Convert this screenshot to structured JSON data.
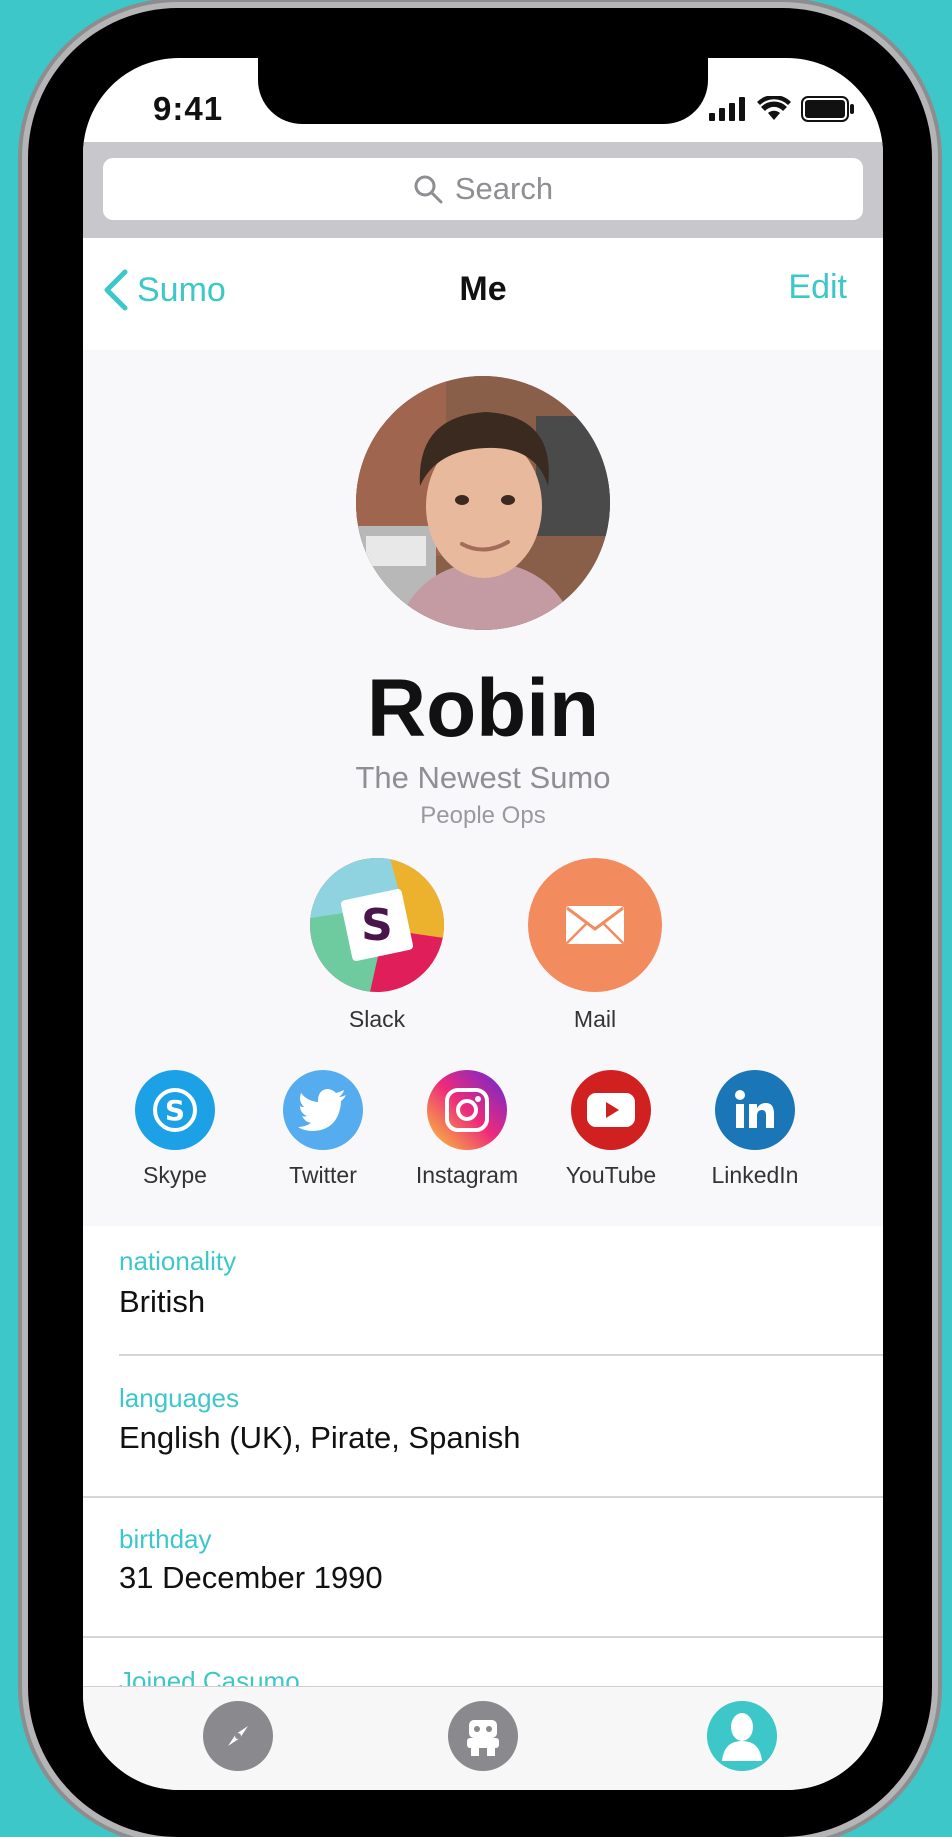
{
  "status": {
    "time": "9:41"
  },
  "search": {
    "placeholder": "Search"
  },
  "nav": {
    "back_label": "Sumo",
    "title": "Me",
    "edit_label": "Edit"
  },
  "profile": {
    "name": "Robin",
    "title": "The Newest Sumo",
    "department": "People Ops"
  },
  "primary_actions": [
    {
      "label": "Slack",
      "icon": "slack-icon"
    },
    {
      "label": "Mail",
      "icon": "mail-icon",
      "color": "#f28b5e"
    }
  ],
  "social_links": [
    {
      "label": "Skype",
      "icon": "skype-icon",
      "color": "#1da1e6"
    },
    {
      "label": "Twitter",
      "icon": "twitter-icon",
      "color": "#55acee"
    },
    {
      "label": "Instagram",
      "icon": "instagram-icon",
      "color": "#c13584"
    },
    {
      "label": "YouTube",
      "icon": "youtube-icon",
      "color": "#d0201f"
    },
    {
      "label": "LinkedIn",
      "icon": "linkedin-icon",
      "color": "#1a76b6"
    }
  ],
  "fields": [
    {
      "key": "nationality",
      "value": "British"
    },
    {
      "key": "languages",
      "value": "English (UK), Pirate, Spanish"
    },
    {
      "key": "birthday",
      "value": "31 December 1990"
    },
    {
      "key": "Joined Casumo",
      "value": ""
    }
  ],
  "tabbar": [
    {
      "icon": "compass-icon",
      "active": false
    },
    {
      "icon": "robot-icon",
      "active": false
    },
    {
      "icon": "profile-icon",
      "active": true
    }
  ],
  "colors": {
    "accent": "#3ec7c9",
    "background": "#3ec7c9"
  }
}
